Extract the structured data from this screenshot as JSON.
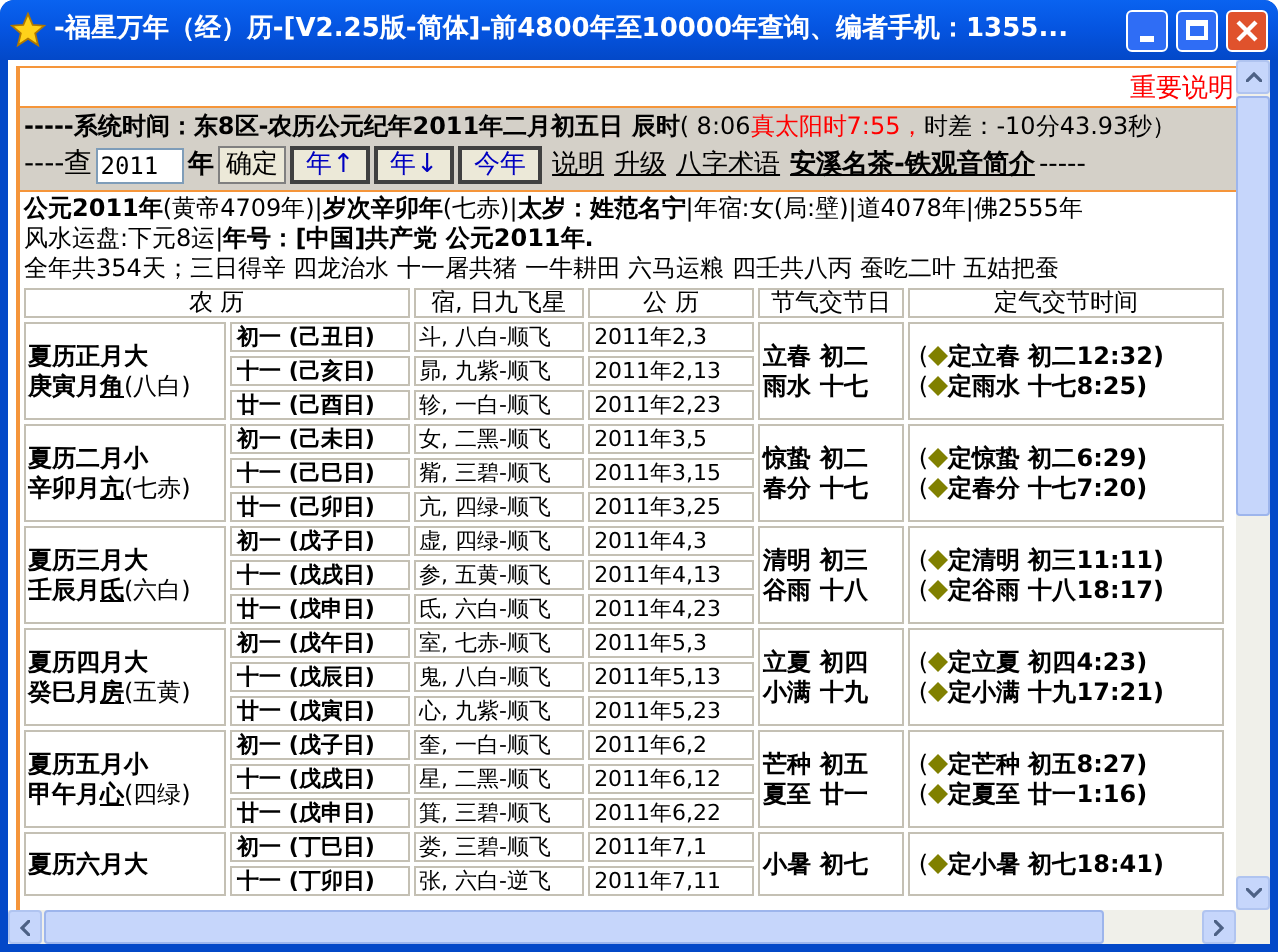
{
  "window": {
    "title": "-福星万年（经）历-[V2.25版-简体]-前4800年至10000年查询、编者手机：1355..."
  },
  "notice_link": "重要说明",
  "system_time": [
    {
      "kind": "bold",
      "text": "-----系统时间：东8区-农历公元纪年2011年二月初五日  辰时"
    },
    {
      "kind": "normal",
      "text": "( 8:06"
    },
    {
      "kind": "red",
      "text": "真太阳时7:55，"
    },
    {
      "kind": "normal",
      "text": "时差：-10分43.93秒）"
    }
  ],
  "query": {
    "label": "----查",
    "year_value": "2011",
    "year_unit": "年",
    "confirm": "确定",
    "year_buttons": [
      "年↑",
      "年↓",
      "今年"
    ],
    "links": [
      {
        "text": "说明",
        "bold": false
      },
      {
        "text": "升级",
        "bold": false
      },
      {
        "text": "八字术语",
        "bold": false
      },
      {
        "text": "安溪名茶-铁观音简介",
        "bold": true
      }
    ],
    "trail": "-----"
  },
  "info_lines": [
    "**公元2011年**(黄帝4709年)|**岁次辛卯年**(七赤)|**太岁：姓范名宁**|年宿:女(局:壁)|道4078年|佛2555年",
    "风水运盘:下元8运|**年号：[中国]共产党  公元2011年.**",
    "全年共354天；三日得辛  四龙治水  十一屠共猪  一牛耕田  六马运粮  四壬共八丙  蚕吃二叶  五姑把蚕"
  ],
  "table": {
    "columns": [
      "农 历",
      "宿, 日九飞星",
      "公 历",
      "节气交节日",
      "定气交节时间"
    ],
    "months": [
      {
        "name": "夏历正月大",
        "ganzhi": "庚寅月",
        "mansion": "角",
        "star": "(八白)",
        "days": [
          {
            "day": "初一 (己丑日)",
            "xiu": "斗, 八白-顺飞",
            "date": "2011年2,3"
          },
          {
            "day": "十一 (己亥日)",
            "xiu": "昴, 九紫-顺飞",
            "date": "2011年2,13"
          },
          {
            "day": "廿一 (己酉日)",
            "xiu": "轸, 一白-顺飞",
            "date": "2011年2,23"
          }
        ],
        "terms": [
          {
            "name": "立春  初二",
            "open": "(",
            "detail": "定立春  初二12:32)"
          },
          {
            "name": "雨水  十七",
            "open": "(",
            "detail": "定雨水  十七8:25)"
          }
        ]
      },
      {
        "name": "夏历二月小",
        "ganzhi": "辛卯月",
        "mansion": "亢",
        "star": "(七赤)",
        "days": [
          {
            "day": "初一 (己未日)",
            "xiu": "女, 二黑-顺飞",
            "date": "2011年3,5"
          },
          {
            "day": "十一 (己巳日)",
            "xiu": "觜, 三碧-顺飞",
            "date": "2011年3,15"
          },
          {
            "day": "廿一 (己卯日)",
            "xiu": "亢, 四绿-顺飞",
            "date": "2011年3,25"
          }
        ],
        "terms": [
          {
            "name": "惊蛰  初二",
            "open": "(",
            "detail": "定惊蛰  初二6:29)"
          },
          {
            "name": "春分  十七",
            "open": "(",
            "detail": "定春分  十七7:20)"
          }
        ]
      },
      {
        "name": "夏历三月大",
        "ganzhi": "壬辰月",
        "mansion": "氐",
        "star": "(六白)",
        "days": [
          {
            "day": "初一 (戊子日)",
            "xiu": "虚, 四绿-顺飞",
            "date": "2011年4,3"
          },
          {
            "day": "十一 (戊戌日)",
            "xiu": "参, 五黄-顺飞",
            "date": "2011年4,13"
          },
          {
            "day": "廿一 (戊申日)",
            "xiu": "氐, 六白-顺飞",
            "date": "2011年4,23"
          }
        ],
        "terms": [
          {
            "name": "清明  初三",
            "open": "(",
            "detail": "定清明  初三11:11)"
          },
          {
            "name": "谷雨  十八",
            "open": "(",
            "detail": "定谷雨  十八18:17)"
          }
        ]
      },
      {
        "name": "夏历四月大",
        "ganzhi": "癸巳月",
        "mansion": "房",
        "star": "(五黄)",
        "days": [
          {
            "day": "初一 (戊午日)",
            "xiu": "室, 七赤-顺飞",
            "date": "2011年5,3"
          },
          {
            "day": "十一 (戊辰日)",
            "xiu": "鬼, 八白-顺飞",
            "date": "2011年5,13"
          },
          {
            "day": "廿一 (戊寅日)",
            "xiu": "心, 九紫-顺飞",
            "date": "2011年5,23"
          }
        ],
        "terms": [
          {
            "name": "立夏  初四",
            "open": "(",
            "detail": "定立夏  初四4:23)"
          },
          {
            "name": "小满  十九",
            "open": "(",
            "detail": "定小满  十九17:21)"
          }
        ]
      },
      {
        "name": "夏历五月小",
        "ganzhi": "甲午月",
        "mansion": "心",
        "star": "(四绿)",
        "days": [
          {
            "day": "初一 (戊子日)",
            "xiu": "奎, 一白-顺飞",
            "date": "2011年6,2"
          },
          {
            "day": "十一 (戊戌日)",
            "xiu": "星, 二黑-顺飞",
            "date": "2011年6,12"
          },
          {
            "day": "廿一 (戊申日)",
            "xiu": "箕, 三碧-顺飞",
            "date": "2011年6,22"
          }
        ],
        "terms": [
          {
            "name": "芒种  初五",
            "open": "(",
            "detail": "定芒种  初五8:27)"
          },
          {
            "name": "夏至  廿一",
            "open": "(",
            "detail": "定夏至  廿一1:16)"
          }
        ]
      },
      {
        "name": "夏历六月大",
        "days": [
          {
            "day": "初一 (丁巳日)",
            "xiu": "娄, 三碧-顺飞",
            "date": "2011年7,1"
          },
          {
            "day": "十一 (丁卯日)",
            "xiu": "张, 六白-逆飞",
            "date": "2011年7,11"
          }
        ],
        "terms": [
          {
            "name": "小暑  初七",
            "open": "(",
            "detail": "定小暑  初七18:41)"
          }
        ]
      }
    ]
  }
}
